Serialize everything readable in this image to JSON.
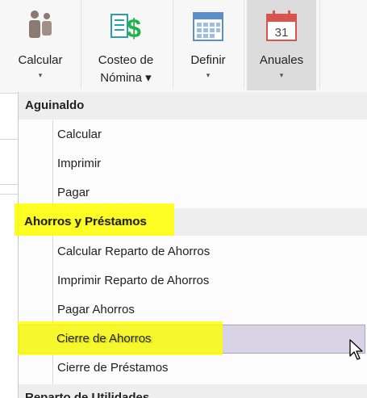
{
  "ribbon": {
    "buttons": [
      {
        "label": "Calcular",
        "icon": "people-calculate-icon"
      },
      {
        "label_line1": "Costeo de",
        "label_line2": "Nómina",
        "icon": "dollar-document-icon"
      },
      {
        "label": "Definir",
        "icon": "grid-calendar-icon"
      },
      {
        "label": "Anuales",
        "icon": "calendar-31-icon",
        "calendar_day": "31"
      }
    ]
  },
  "menu": {
    "sections": [
      {
        "header": "Aguinaldo",
        "items": [
          "Calcular",
          "Imprimir",
          "Pagar"
        ]
      },
      {
        "header": "Ahorros y Préstamos",
        "items": [
          "Calcular Reparto de Ahorros",
          "Imprimir Reparto de Ahorros",
          "Pagar Ahorros",
          "Cierre de Ahorros",
          "Cierre de Préstamos"
        ]
      },
      {
        "header": "Reparto de Utilidades",
        "items": []
      }
    ]
  },
  "colors": {
    "highlight": "#ffff00",
    "hover": "#d8d4e6",
    "calendar_red": "#d9534f"
  }
}
